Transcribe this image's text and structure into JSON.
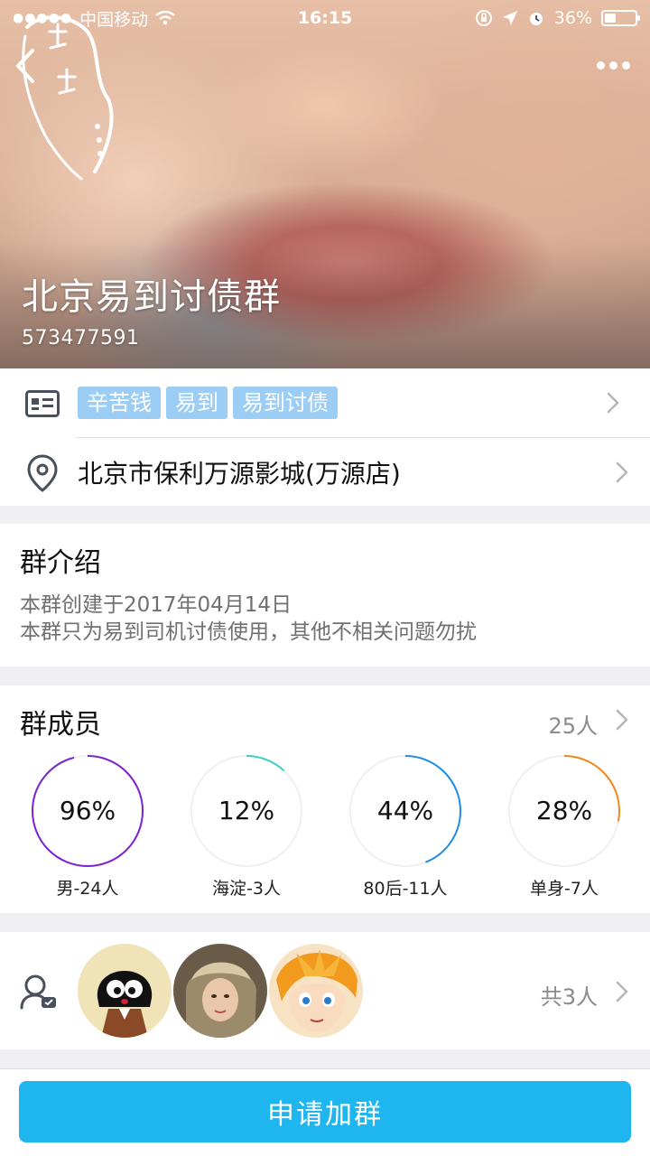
{
  "status_bar": {
    "carrier": "中国移动",
    "time": "16:15",
    "battery": "36%"
  },
  "header": {
    "group_name": "北京易到讨债群",
    "group_id": "573477591",
    "back_icon": "chevron-left-icon",
    "more_icon": "more-dots-icon"
  },
  "tags_row": {
    "icon": "id-card-icon",
    "tags": [
      "辛苦钱",
      "易到",
      "易到讨债"
    ],
    "tag_color": "#9ccdf4"
  },
  "location_row": {
    "icon": "location-pin-icon",
    "text": "北京市保利万源影城(万源店)"
  },
  "intro": {
    "title": "群介绍",
    "lines": [
      "本群创建于2017年04月14日",
      "本群只为易到司机讨债使用，其他不相关问题勿扰"
    ]
  },
  "members": {
    "title": "群成员",
    "count": "25人",
    "stats": [
      {
        "percent": "96%",
        "value": 0.96,
        "label": "男-24人",
        "color": "#7b22d4"
      },
      {
        "percent": "12%",
        "value": 0.12,
        "label": "海淀-3人",
        "color": "#3ecfc5"
      },
      {
        "percent": "44%",
        "value": 0.44,
        "label": "80后-11人",
        "color": "#1e8ee6"
      },
      {
        "percent": "28%",
        "value": 0.28,
        "label": "单身-7人",
        "color": "#f08a1c"
      }
    ]
  },
  "admins": {
    "icon": "admin-user-icon",
    "total": "共3人"
  },
  "action": {
    "join_label": "申请加群",
    "color": "#1fb5ee"
  }
}
